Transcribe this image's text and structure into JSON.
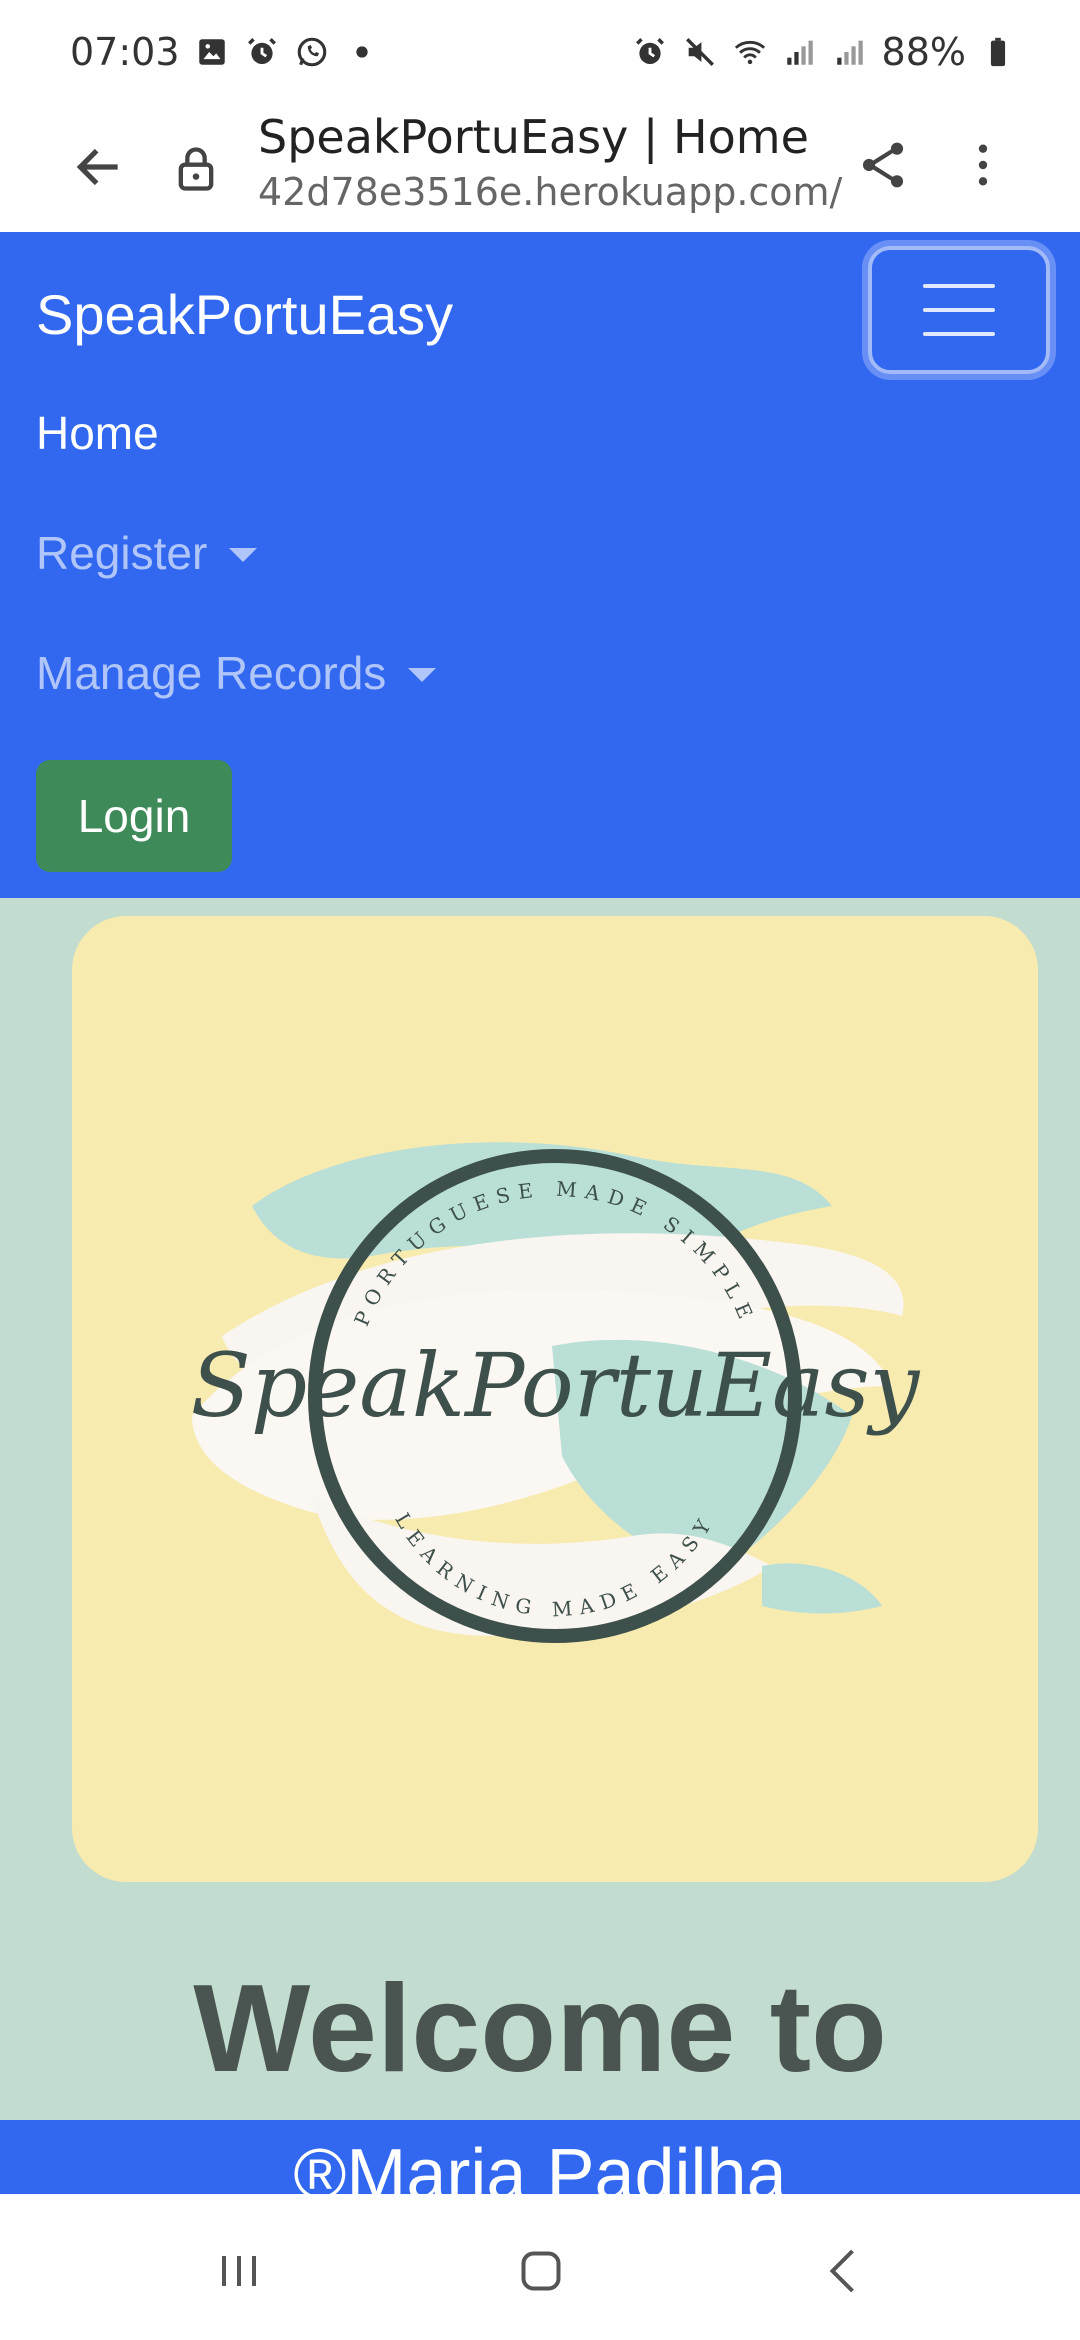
{
  "status_bar": {
    "time": "07:03",
    "battery": "88%",
    "left_icons": [
      "gallery-icon",
      "alarm-icon",
      "whatsapp-icon",
      "dot-icon"
    ],
    "right_icons": [
      "alarm-icon",
      "mute-icon",
      "wifi-icon",
      "signal-icon",
      "signal-icon",
      "battery-icon"
    ]
  },
  "browser": {
    "title": "SpeakPortuEasy | Home",
    "url": "42d78e3516e.herokuapp.com/"
  },
  "navbar": {
    "brand": "SpeakPortuEasy",
    "links": {
      "home": "Home",
      "register": "Register",
      "manage": "Manage Records"
    },
    "login": "Login",
    "color": "#3168ef"
  },
  "logo": {
    "script_text": "SpeakPortuEasy",
    "ring_top": "PORTUGUESE MADE SIMPLE",
    "ring_bottom": "LEARNING MADE EASY"
  },
  "main": {
    "welcome": "Welcome to",
    "footer_partial": "®Maria Padilha"
  },
  "colors": {
    "page_bg": "#c2dcd0",
    "card_bg": "#f8ebb0",
    "login_bg": "#3e8a59"
  }
}
